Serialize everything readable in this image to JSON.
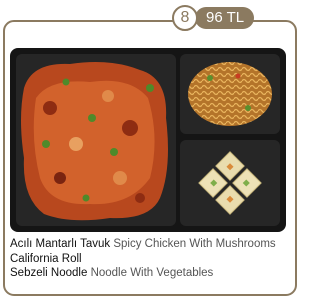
{
  "badge": {
    "number": "8",
    "price": "96 TL"
  },
  "colors": {
    "accent": "#8b7a60",
    "tray": "#151515"
  },
  "menu": [
    {
      "name_tr": "Acılı Mantarlı Tavuk",
      "name_en": "Spicy Chicken With Mushrooms"
    },
    {
      "name_tr": "California  Roll",
      "name_en": ""
    },
    {
      "name_tr": "Sebzeli Noodle",
      "name_en": "Noodle With Vegetables"
    }
  ]
}
